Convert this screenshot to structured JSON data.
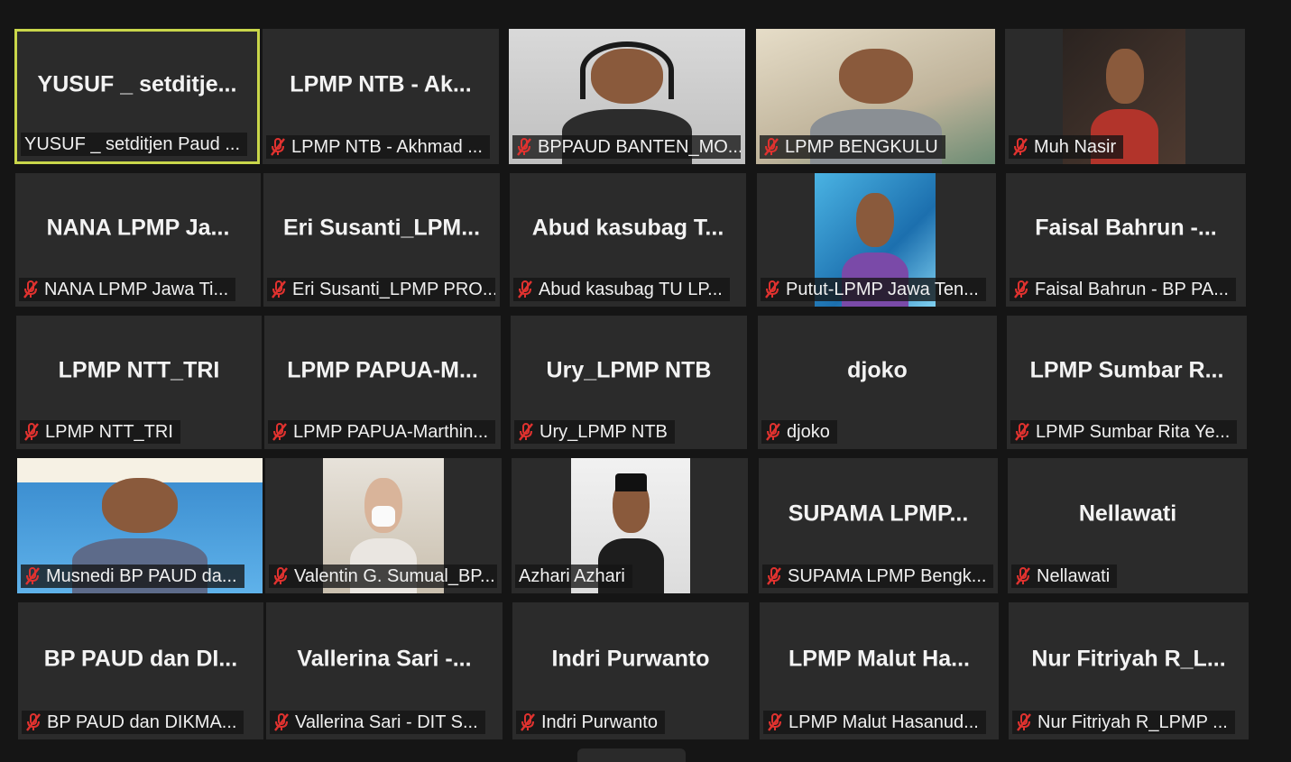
{
  "colors": {
    "background": "#151515",
    "tile": "#2b2b2b",
    "active_speaker_border": "#c9d64a",
    "muted_icon": "#e0322f"
  },
  "participants": [
    {
      "big": "YUSUF _ setditje...",
      "label": "YUSUF _ setditjen Paud ...",
      "muted": false,
      "active": true,
      "video": false
    },
    {
      "big": "LPMP NTB - Ak...",
      "label": "LPMP NTB - Akhmad ...",
      "muted": true,
      "video": false
    },
    {
      "big": "",
      "label": "BPPAUD BANTEN_MO...",
      "muted": true,
      "video": true,
      "cam": "headset"
    },
    {
      "big": "",
      "label": "LPMP BENGKULU",
      "muted": true,
      "video": true,
      "cam": "room"
    },
    {
      "big": "",
      "label": "Muh Nasir",
      "muted": true,
      "video": true,
      "cam": "dark"
    },
    {
      "big": "NANA LPMP Ja...",
      "label": "NANA LPMP Jawa Ti...",
      "muted": true,
      "video": false
    },
    {
      "big": "Eri Susanti_LPM...",
      "label": "Eri Susanti_LPMP PRO...",
      "muted": true,
      "video": false
    },
    {
      "big": "Abud kasubag T...",
      "label": "Abud kasubag TU LP...",
      "muted": true,
      "video": false
    },
    {
      "big": "",
      "label": "Putut-LPMP Jawa Ten...",
      "muted": true,
      "video": true,
      "cam": "blue"
    },
    {
      "big": "Faisal Bahrun -...",
      "label": "Faisal Bahrun - BP PA...",
      "muted": true,
      "video": false
    },
    {
      "big": "LPMP NTT_TRI",
      "label": "LPMP NTT_TRI",
      "muted": true,
      "video": false
    },
    {
      "big": "LPMP PAPUA-M...",
      "label": "LPMP PAPUA-Marthin...",
      "muted": true,
      "video": false
    },
    {
      "big": "Ury_LPMP NTB",
      "label": "Ury_LPMP NTB",
      "muted": true,
      "video": false
    },
    {
      "big": "djoko",
      "label": "djoko",
      "muted": true,
      "video": false
    },
    {
      "big": "LPMP Sumbar R...",
      "label": "LPMP Sumbar Rita Ye...",
      "muted": true,
      "video": false
    },
    {
      "big": "",
      "label": "Musnedi BP PAUD da...",
      "muted": true,
      "video": true,
      "cam": "banner"
    },
    {
      "big": "",
      "label": "Valentin G. Sumual_BP...",
      "muted": true,
      "video": true,
      "cam": "mask"
    },
    {
      "big": "",
      "label": "Azhari Azhari",
      "muted": false,
      "video": true,
      "cam": "portrait"
    },
    {
      "big": "SUPAMA LPMP...",
      "label": "SUPAMA LPMP Bengk...",
      "muted": true,
      "video": false
    },
    {
      "big": "Nellawati",
      "label": "Nellawati",
      "muted": true,
      "video": false
    },
    {
      "big": "BP PAUD dan DI...",
      "label": "BP PAUD dan DIKMA...",
      "muted": true,
      "video": false
    },
    {
      "big": "Vallerina Sari -...",
      "label": "Vallerina Sari - DIT S...",
      "muted": true,
      "video": false
    },
    {
      "big": "Indri Purwanto",
      "label": "Indri Purwanto",
      "muted": true,
      "video": false
    },
    {
      "big": "LPMP Malut Ha...",
      "label": "LPMP Malut Hasanud...",
      "muted": true,
      "video": false
    },
    {
      "big": "Nur Fitriyah R_L...",
      "label": "Nur Fitriyah R_LPMP ...",
      "muted": true,
      "video": false
    }
  ]
}
